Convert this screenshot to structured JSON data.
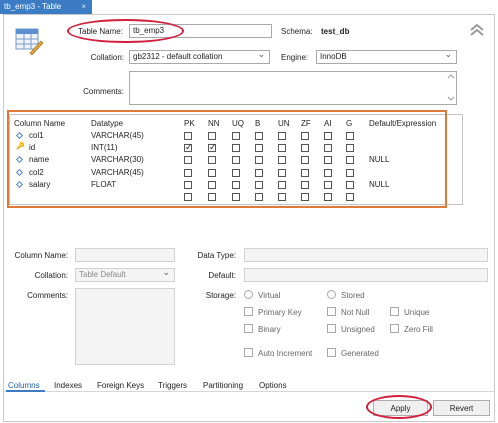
{
  "window": {
    "tab_title": "tb_emp3 - Table",
    "close_glyph": "×"
  },
  "table_info": {
    "table_name_label": "Table Name:",
    "table_name_value": "tb_emp3",
    "schema_label": "Schema:",
    "schema_value": "test_db",
    "collation_label": "Collation:",
    "collation_value": "gb2312 - default collation",
    "engine_label": "Engine:",
    "engine_value": "InnoDB",
    "comments_label": "Comments:",
    "comments_value": ""
  },
  "grid": {
    "headers": [
      "Column Name",
      "Datatype",
      "PK",
      "NN",
      "UQ",
      "B",
      "UN",
      "ZF",
      "AI",
      "G",
      "Default/Expression"
    ],
    "rows": [
      {
        "icon": "diamond-icon",
        "name": "col1",
        "datatype": "VARCHAR(45)",
        "flags": [
          false,
          false,
          false,
          false,
          false,
          false,
          false,
          false
        ],
        "default": ""
      },
      {
        "icon": "key-icon",
        "name": "id",
        "datatype": "INT(11)",
        "flags": [
          true,
          true,
          false,
          false,
          false,
          false,
          false,
          false
        ],
        "default": ""
      },
      {
        "icon": "diamond-icon",
        "name": "name",
        "datatype": "VARCHAR(30)",
        "flags": [
          false,
          false,
          false,
          false,
          false,
          false,
          false,
          false
        ],
        "default": "NULL"
      },
      {
        "icon": "diamond-icon",
        "name": "col2",
        "datatype": "VARCHAR(45)",
        "flags": [
          false,
          false,
          false,
          false,
          false,
          false,
          false,
          false
        ],
        "default": ""
      },
      {
        "icon": "diamond-icon",
        "name": "salary",
        "datatype": "FLOAT",
        "flags": [
          false,
          false,
          false,
          false,
          false,
          false,
          false,
          false
        ],
        "default": "NULL"
      },
      {
        "icon": "",
        "name": "",
        "datatype": "",
        "flags": [
          false,
          false,
          false,
          false,
          false,
          false,
          false,
          false
        ],
        "default": ""
      }
    ]
  },
  "column_details": {
    "column_name_label": "Column Name:",
    "column_name_value": "",
    "data_type_label": "Data Type:",
    "data_type_value": "",
    "collation_label": "Collation:",
    "collation_value": "Table Default",
    "default_label": "Default:",
    "default_value": "",
    "comments_label": "Comments:",
    "storage_label": "Storage:",
    "storage_options": [
      "Virtual",
      "Stored"
    ],
    "checkboxes": [
      "Primary Key",
      "Not Null",
      "Unique",
      "Binary",
      "Unsigned",
      "Zero Fill",
      "Auto Increment",
      "Generated"
    ]
  },
  "bottom_tabs": [
    "Columns",
    "Indexes",
    "Foreign Keys",
    "Triggers",
    "Partitioning",
    "Options"
  ],
  "buttons": {
    "apply": "Apply",
    "revert": "Revert"
  },
  "colors": {
    "tab_blue": "#3b7cc4",
    "annotation_red": "#d11f3c",
    "annotation_orange": "#e07a38"
  }
}
